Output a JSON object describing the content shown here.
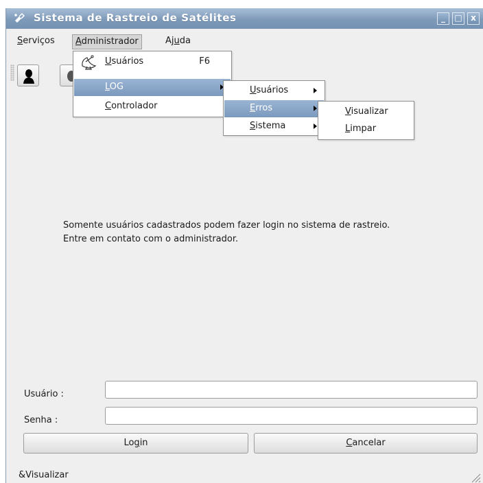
{
  "window": {
    "title": "Sistema de Rastreio de Satélites",
    "controls": {
      "minimize": "_",
      "maximize": "□",
      "close": "x"
    }
  },
  "menubar": {
    "servicos": {
      "pre": "",
      "ul": "S",
      "post": "erviços"
    },
    "administrador": {
      "pre": "",
      "ul": "A",
      "post": "dministrador"
    },
    "ajuda": {
      "pre": "Aj",
      "ul": "u",
      "post": "da"
    }
  },
  "toolbar": {
    "icons": [
      "user-icon",
      "second-tool-icon"
    ]
  },
  "admin_menu": {
    "usuarios": {
      "pre": "",
      "ul": "U",
      "post": "suários",
      "shortcut": "F6",
      "icon": "satellite-dish-icon"
    },
    "log": {
      "pre": "",
      "ul": "L",
      "post": "OG"
    },
    "controlador": {
      "pre": "",
      "ul": "C",
      "post": "ontrolador"
    }
  },
  "log_menu": {
    "usuarios": {
      "pre": "",
      "ul": "U",
      "post": "suários"
    },
    "erros": {
      "pre": "",
      "ul": "E",
      "post": "rros"
    },
    "sistema": {
      "pre": "",
      "ul": "S",
      "post": "istema"
    }
  },
  "erros_menu": {
    "visualizar": {
      "pre": "",
      "ul": "V",
      "post": "isualizar"
    },
    "limpar": {
      "pre": "",
      "ul": "L",
      "post": "impar"
    }
  },
  "info": {
    "line1": "Somente usuários cadastrados podem fazer login no sistema de rastreio.",
    "line2": "Entre em contato com o administrador."
  },
  "form": {
    "usuario_label": "Usuário :",
    "usuario_value": "",
    "senha_label": "Senha :",
    "senha_value": "",
    "login_button": {
      "pre": "Lo",
      "ul": "g",
      "post": "in"
    },
    "cancel_button": {
      "pre": "",
      "ul": "C",
      "post": "ancelar"
    }
  },
  "status": {
    "text": "&Visualizar"
  },
  "colors": {
    "titlebar": "#7e9ab9",
    "highlight": "#8aa7c8"
  }
}
